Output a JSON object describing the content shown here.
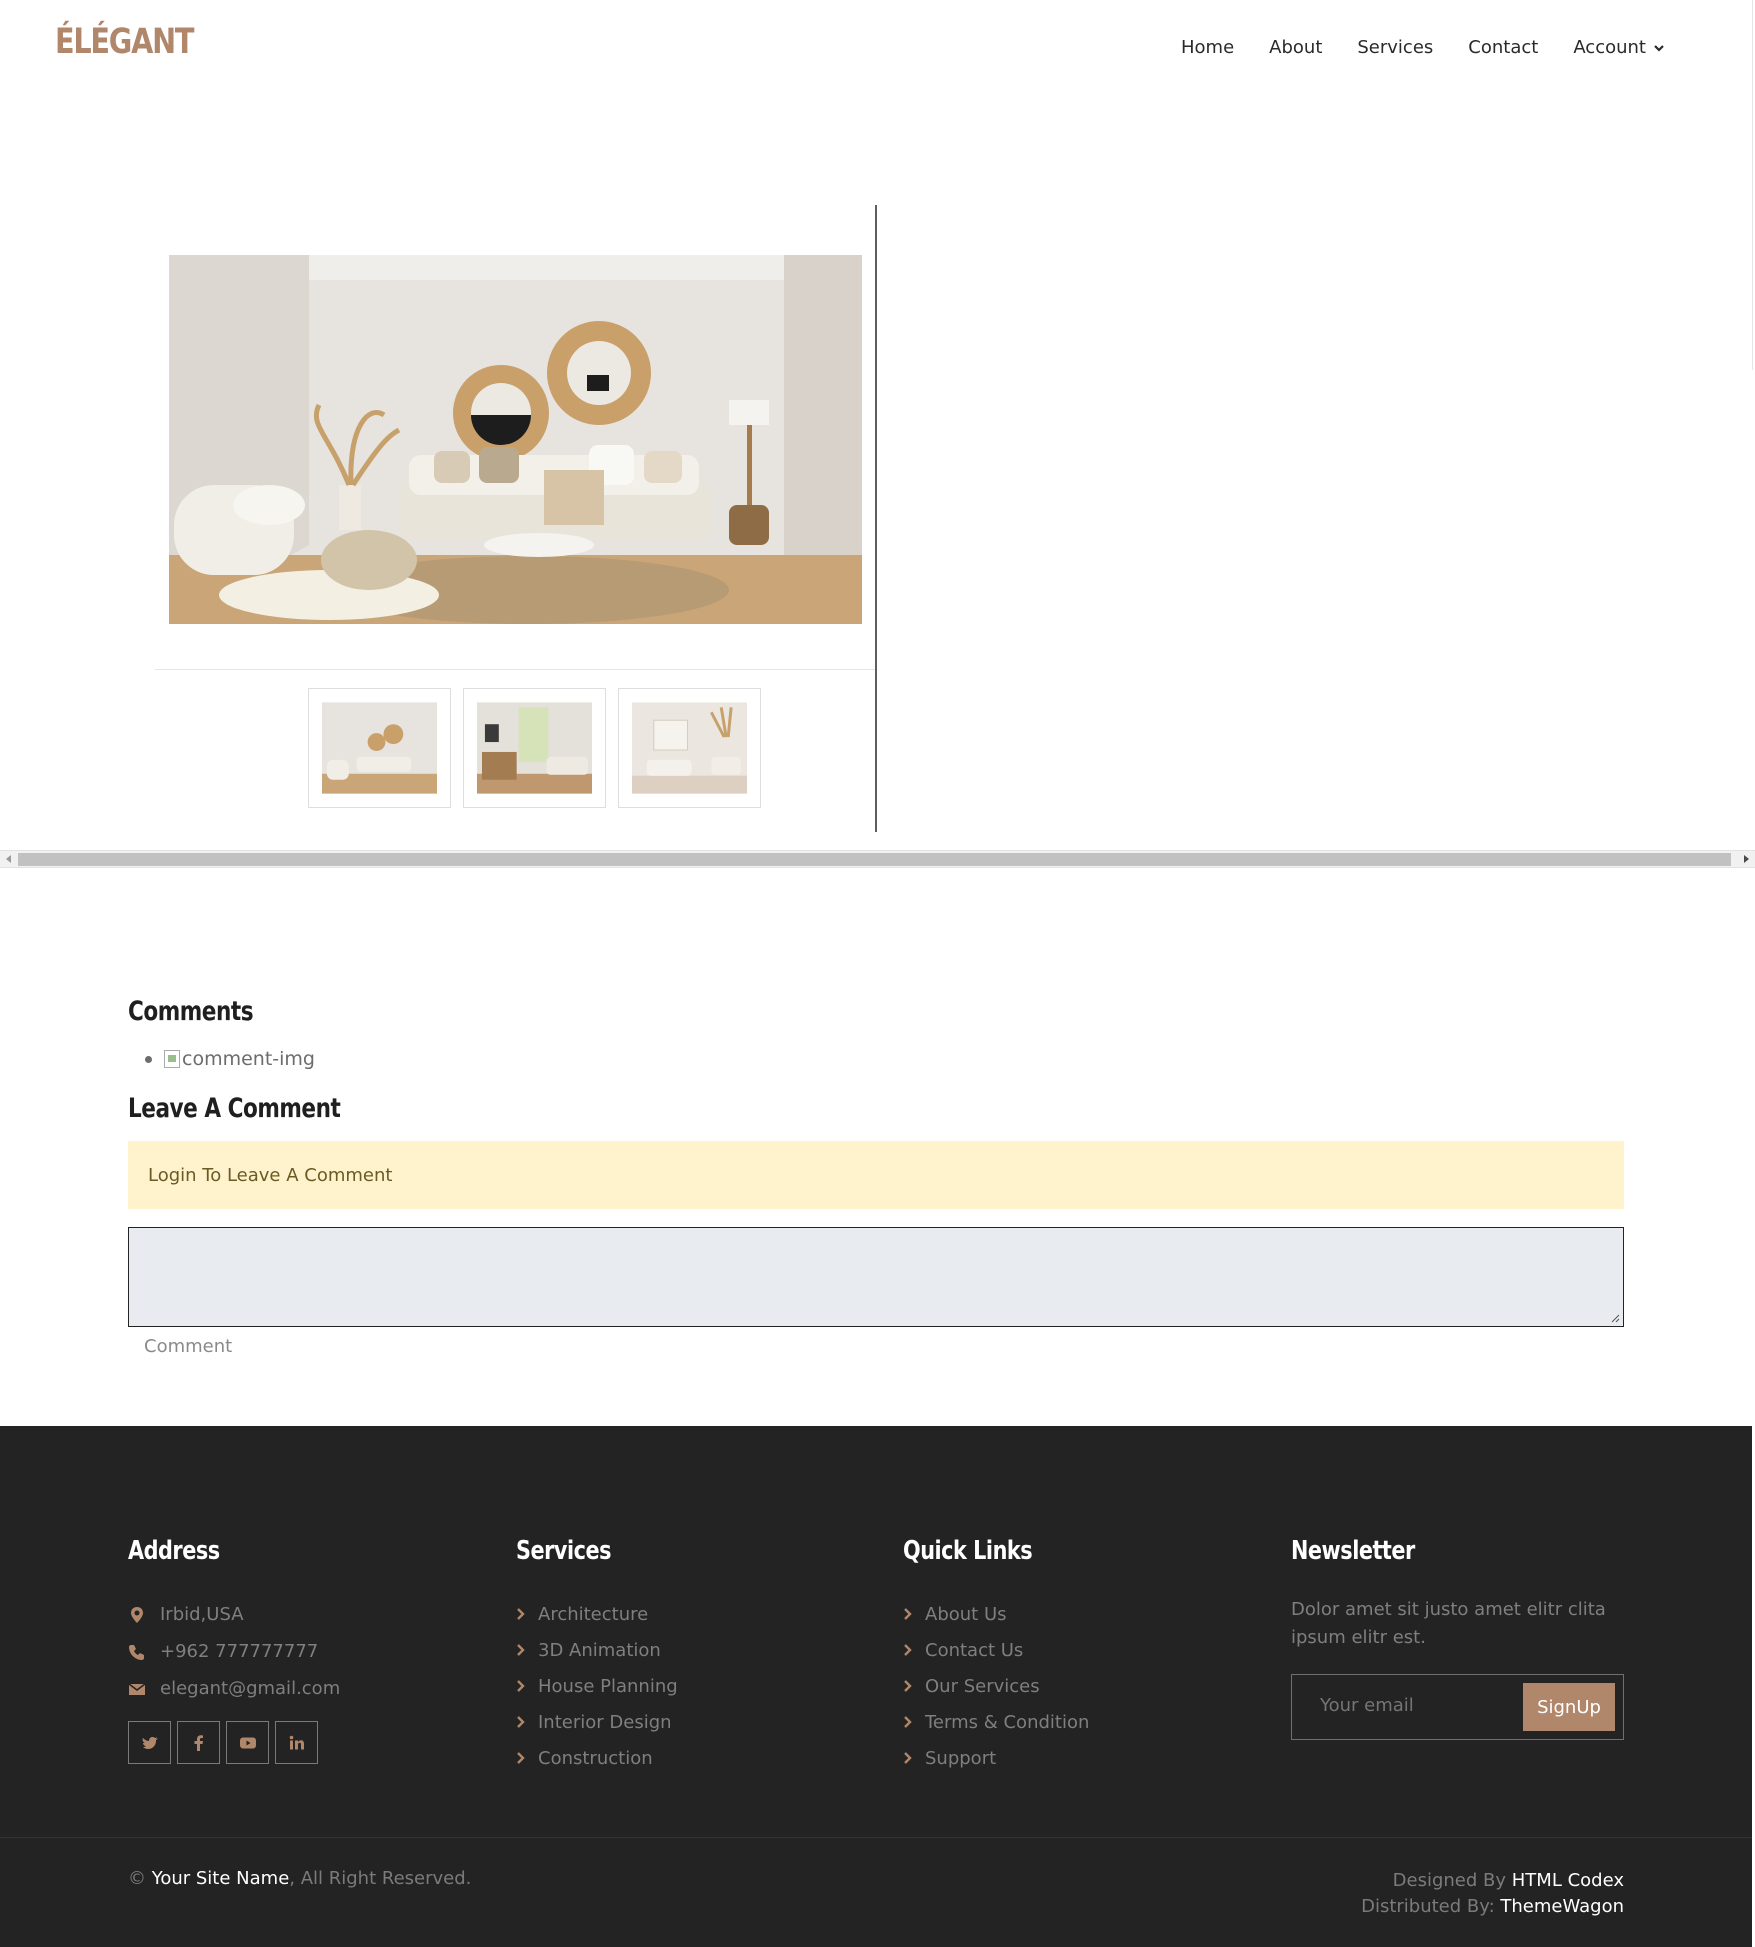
{
  "brand": {
    "logo": "ÉLÉGANT"
  },
  "nav": {
    "home": "Home",
    "about": "About",
    "services": "Services",
    "contact": "Contact",
    "account": "Account"
  },
  "comments": {
    "title": "Comments",
    "item_alt": "comment-img",
    "leave_title": "Leave A Comment",
    "login_notice": "Login To Leave A Comment",
    "comment_label": "Comment"
  },
  "footer": {
    "address": {
      "title": "Address",
      "location": "Irbid,USA",
      "phone": "+962 777777777",
      "email": "elegant@gmail.com"
    },
    "services": {
      "title": "Services",
      "items": [
        "Architecture",
        "3D Animation",
        "House Planning",
        "Interior Design",
        "Construction"
      ]
    },
    "quick_links": {
      "title": "Quick Links",
      "items": [
        "About Us",
        "Contact Us",
        "Our Services",
        "Terms & Condition",
        "Support"
      ]
    },
    "newsletter": {
      "title": "Newsletter",
      "text": "Dolor amet sit justo amet elitr clita ipsum elitr est.",
      "placeholder": "Your email",
      "button": "SignUp"
    },
    "copyright_prefix": "©",
    "site_name": "Your Site Name",
    "rights": ", All Right Reserved.",
    "designed_by_label": "Designed By",
    "designed_by": "HTML Codex",
    "distributed_by_label": "Distributed By:",
    "distributed_by": "ThemeWagon"
  },
  "colors": {
    "accent": "#b0876a",
    "footer_bg": "#232323",
    "alert_bg": "#fff3cd"
  },
  "icons": [
    "chevron-down-icon",
    "map-marker-icon",
    "phone-icon",
    "envelope-icon",
    "twitter-icon",
    "facebook-icon",
    "youtube-icon",
    "linkedin-icon",
    "chevron-right-icon"
  ]
}
